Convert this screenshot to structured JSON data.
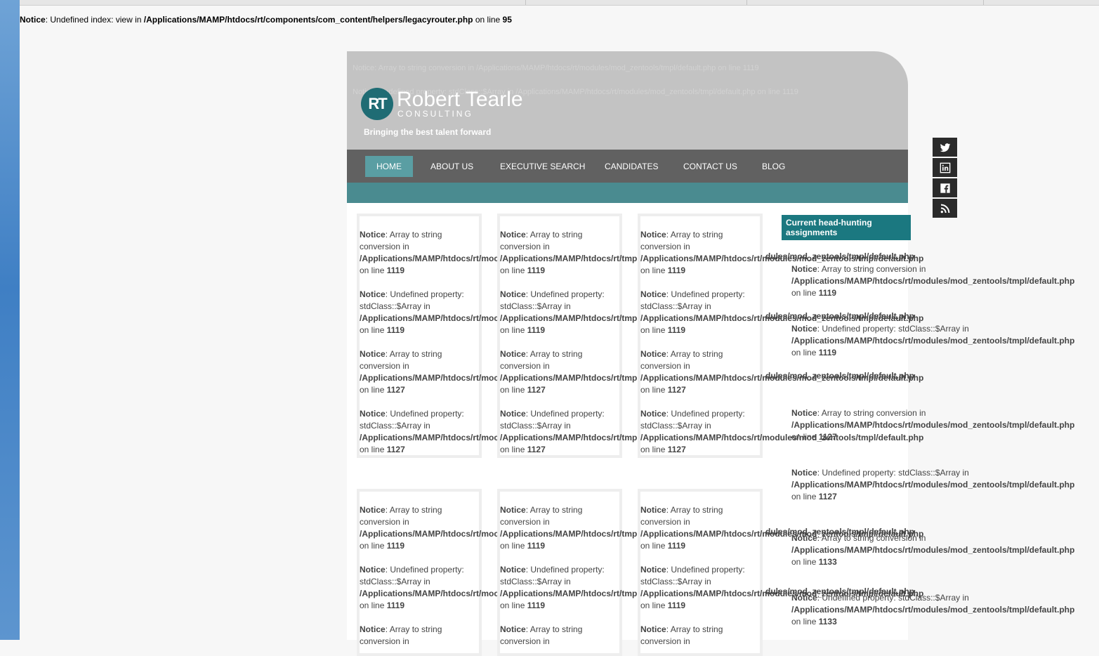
{
  "top_notice": {
    "label": "Notice",
    "text": ": Undefined index: view in ",
    "path": "/Applications/MAMP/htdocs/rt/components/com_content/helpers/legacyrouter.php",
    "on_line": " on line ",
    "line": "95"
  },
  "header": {
    "ghost1": "Notice: Array to string conversion in /Applications/MAMP/htdocs/rt/modules/mod_zentools/tmpl/default.php on line 1119",
    "ghost2": "Notice: Undefined property: stdClass::$Array in /Applications/MAMP/htdocs/rt/modules/mod_zentools/tmpl/default.php on line 1119",
    "logo_initials": "RT",
    "logo_name": "Robert Tearle",
    "logo_sub": "CONSULTING",
    "tagline": "Bringing the best talent forward"
  },
  "nav": {
    "items": [
      "HOME",
      "ABOUT US",
      "EXECUTIVE SEARCH",
      "CANDIDATES",
      "CONTACT US",
      "BLOG"
    ]
  },
  "notices": {
    "label": "Notice",
    "array_msg": ": Array to string conversion in",
    "prop_msg": ": Undefined property: stdClass::$Array in",
    "card_path": "/Applications/MAMP/htdocs/rt/moc",
    "card_path_2": "/Applications/MAMP/htdocs/rt/tmpl",
    "card_path_3": "/Applications/MAMP/htdocs/rt/modules/mod_zentools/tmpl/default.php",
    "full_path": "/Applications/MAMP/htdocs/rt/modules/mod_zentools/tmpl/default.php",
    "overflow_path": "dules/mod_zentools/tmpl/default.php",
    "on_line": "on line ",
    "l1119": "1119",
    "l1127": "1127",
    "l1133": "1133"
  },
  "sidebar": {
    "heading": "Current head-hunting assignments"
  },
  "social": [
    "twitter-icon",
    "linkedin-icon",
    "facebook-icon",
    "rss-icon"
  ]
}
